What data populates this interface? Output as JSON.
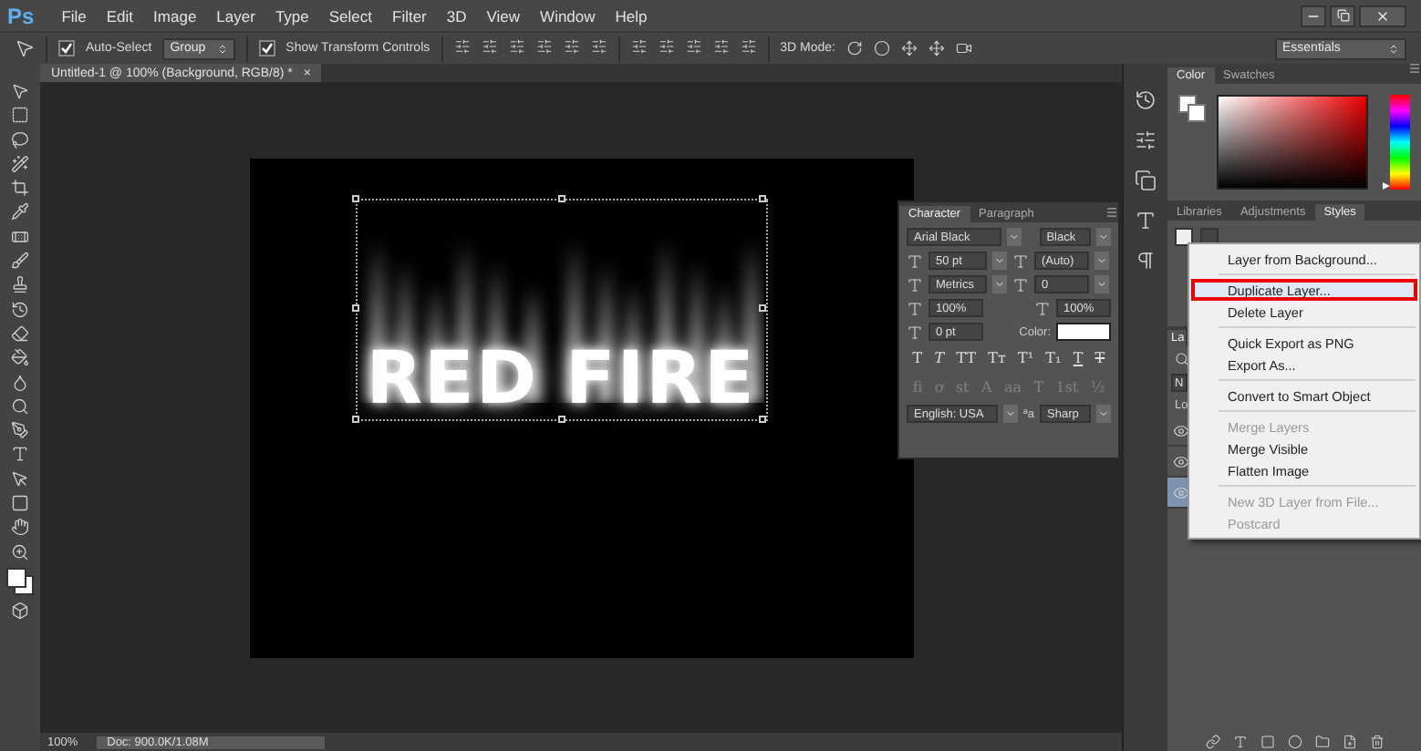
{
  "app_logo": "Ps",
  "menu_bar": [
    "File",
    "Edit",
    "Image",
    "Layer",
    "Type",
    "Select",
    "Filter",
    "3D",
    "View",
    "Window",
    "Help"
  ],
  "options_bar": {
    "auto_select": {
      "label": "Auto-Select",
      "checked": true
    },
    "auto_select_target": "Group",
    "show_transform_controls": {
      "label": "Show Transform Controls",
      "checked": true
    },
    "mode_label": "3D Mode:",
    "workspace": "Essentials"
  },
  "document_tab": {
    "title": "Untitled-1 @ 100% (Background, RGB/8) *",
    "close": "×"
  },
  "canvas": {
    "text": "RED FIRE"
  },
  "status_bar": {
    "zoom": "100%",
    "doc_info": "Doc: 900.0K/1.08M"
  },
  "character_panel": {
    "tabs": [
      {
        "label": "Character",
        "selected": true
      },
      {
        "label": "Paragraph",
        "selected": false
      }
    ],
    "font_family": "Arial Black",
    "font_style": "Black",
    "size": "50 pt",
    "leading": "(Auto)",
    "kerning": "Metrics",
    "tracking": "0",
    "vertical_scale": "100%",
    "horizontal_scale": "100%",
    "baseline_shift": "0 pt",
    "color_label": "Color:",
    "color": "#ffffff",
    "style_buttons": [
      {
        "glyph": "T",
        "kind": "bold"
      },
      {
        "glyph": "T",
        "kind": "italic"
      },
      {
        "glyph": "TT",
        "kind": "caps"
      },
      {
        "glyph": "Tт",
        "kind": "smallcaps"
      },
      {
        "glyph": "T¹",
        "kind": "super"
      },
      {
        "glyph": "T₁",
        "kind": "sub"
      },
      {
        "glyph": "T",
        "kind": "underline"
      },
      {
        "glyph": "T",
        "kind": "strike"
      }
    ],
    "opentype_buttons": [
      {
        "glyph": "fi",
        "disabled": true
      },
      {
        "glyph": "ơ",
        "disabled": true
      },
      {
        "glyph": "st",
        "disabled": true
      },
      {
        "glyph": "A",
        "disabled": true
      },
      {
        "glyph": "aa",
        "disabled": true
      },
      {
        "glyph": "T",
        "disabled": true
      },
      {
        "glyph": "1st",
        "disabled": true
      },
      {
        "glyph": "½",
        "disabled": true
      }
    ],
    "language": "English: USA",
    "antialias_label": "ªa",
    "antialias": "Sharp"
  },
  "color_panel": {
    "tabs": [
      {
        "label": "Color",
        "selected": true
      },
      {
        "label": "Swatches",
        "selected": false
      }
    ],
    "hue_slider": {
      "level": 0
    }
  },
  "styles_panel": {
    "tabs": [
      {
        "label": "Libraries",
        "selected": false
      },
      {
        "label": "Adjustments",
        "selected": false
      },
      {
        "label": "Styles",
        "selected": true
      }
    ]
  },
  "layers_panel": {
    "tab": "La",
    "blend_mode": "N",
    "lock_label": "Lo",
    "layers": [
      {
        "visible": true,
        "selected": false
      },
      {
        "visible": true,
        "selected": false
      },
      {
        "visible": true,
        "selected": true
      }
    ]
  },
  "context_menu": [
    {
      "kind": "item",
      "label": "Layer from Background...",
      "disabled": false,
      "selected": false
    },
    {
      "kind": "separator"
    },
    {
      "kind": "item",
      "label": "Duplicate Layer...",
      "disabled": false,
      "selected": true
    },
    {
      "kind": "item",
      "label": "Delete Layer",
      "disabled": false,
      "selected": false
    },
    {
      "kind": "separator"
    },
    {
      "kind": "item",
      "label": "Quick Export as PNG",
      "disabled": false,
      "selected": false
    },
    {
      "kind": "item",
      "label": "Export As...",
      "disabled": false,
      "selected": false
    },
    {
      "kind": "separator"
    },
    {
      "kind": "item",
      "label": "Convert to Smart Object",
      "disabled": false,
      "selected": false
    },
    {
      "kind": "separator"
    },
    {
      "kind": "item",
      "label": "Merge Layers",
      "disabled": true,
      "selected": false
    },
    {
      "kind": "item",
      "label": "Merge Visible",
      "disabled": false,
      "selected": false
    },
    {
      "kind": "item",
      "label": "Flatten Image",
      "disabled": false,
      "selected": false
    },
    {
      "kind": "separator"
    },
    {
      "kind": "item",
      "label": "New 3D Layer from File...",
      "disabled": true,
      "selected": false
    },
    {
      "kind": "item",
      "label": "Postcard",
      "disabled": true,
      "selected": false
    }
  ]
}
